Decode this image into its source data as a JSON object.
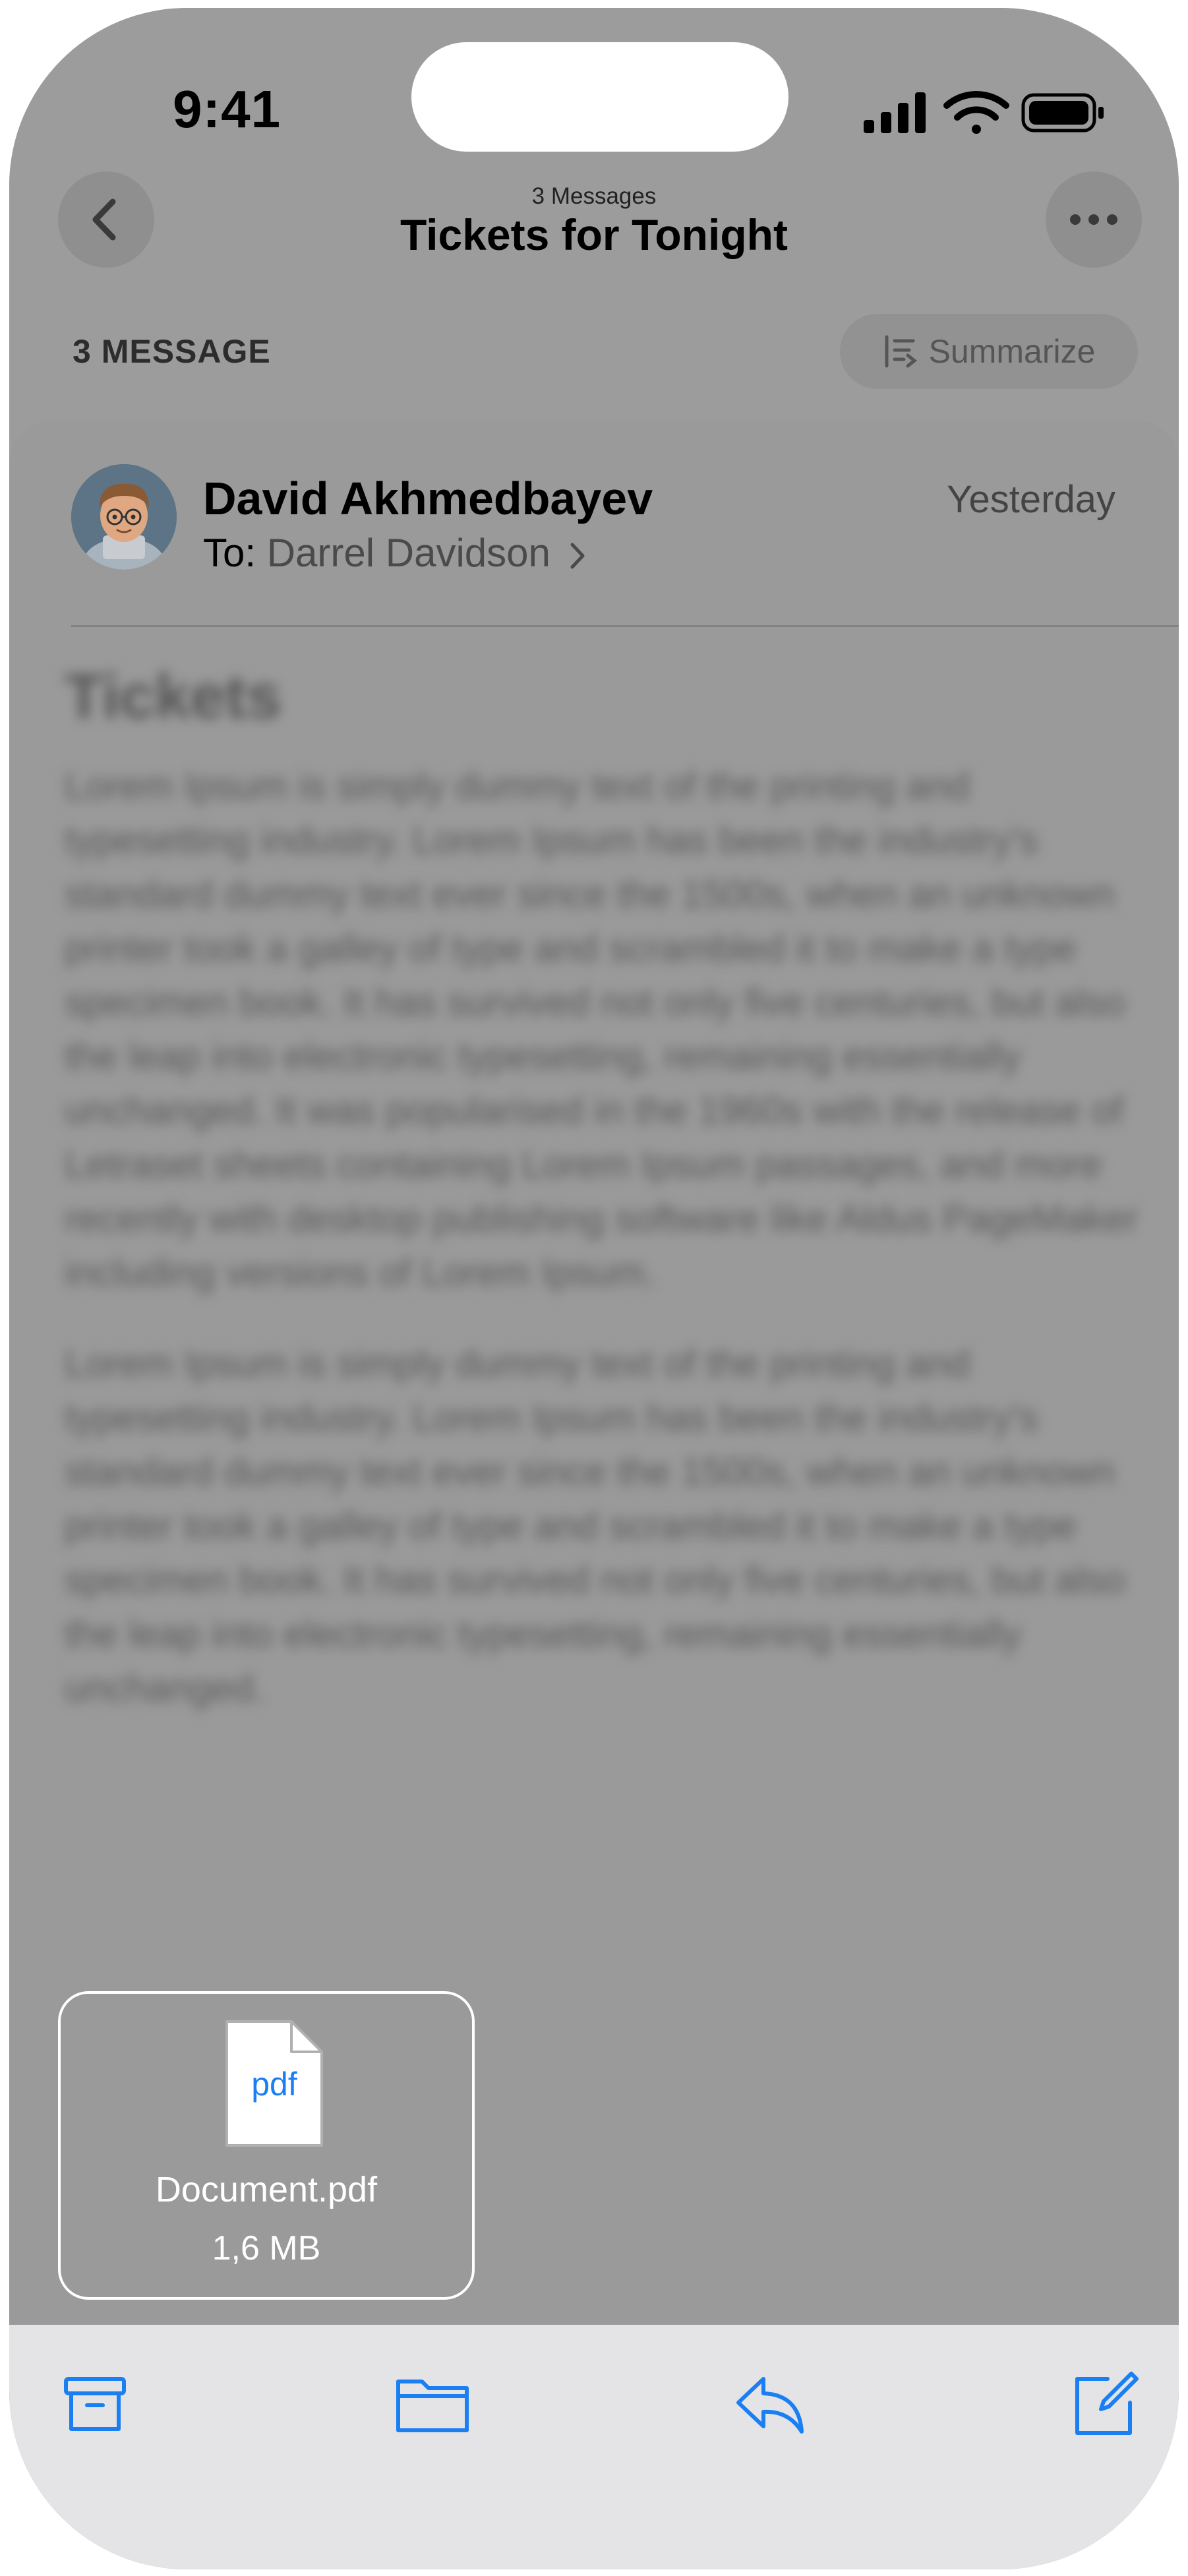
{
  "status_bar": {
    "time": "9:41"
  },
  "header": {
    "subtitle": "3 Messages",
    "title": "Tickets for Tonight"
  },
  "thread_bar": {
    "count_label": "3 MESSAGE",
    "summarize_label": "Summarize"
  },
  "message": {
    "sender": "David Akhmedbayev",
    "to_prefix": "To:",
    "to_name": "Darrel Davidson",
    "date": "Yesterday",
    "body_title": "Tickets",
    "body_paragraphs": [
      "Lorem Ipsum is simply dummy text of the printing and typesetting industry. Lorem Ipsum has been the industry's standard dummy text ever since the 1500s, when an unknown printer took a galley of type and scrambled it to make a type specimen book. It has survived not only five centuries, but also the leap into electronic typesetting, remaining essentially unchanged. It was popularised in the 1960s with the release of Letraset sheets containing Lorem Ipsum passages, and more recently with desktop publishing software like Aldus PageMaker including versions of Lorem Ipsum.",
      "Lorem Ipsum is simply dummy text of the printing and typesetting industry. Lorem Ipsum has been the industry's standard dummy text ever since the 1500s, when an unknown printer took a galley of type and scrambled it to make a type specimen book. It has survived not only five centuries, but also the leap into electronic typesetting, remaining essentially unchanged."
    ]
  },
  "attachment": {
    "icon_label": "pdf",
    "name": "Document.pdf",
    "size": "1,6 MB"
  },
  "toolbar": {
    "icons": [
      "archive-icon",
      "folder-icon",
      "reply-icon",
      "compose-icon"
    ]
  },
  "colors": {
    "accent": "#1a7ff2",
    "overlay": "#999999",
    "toolbar_bg": "#e4e4e6"
  }
}
